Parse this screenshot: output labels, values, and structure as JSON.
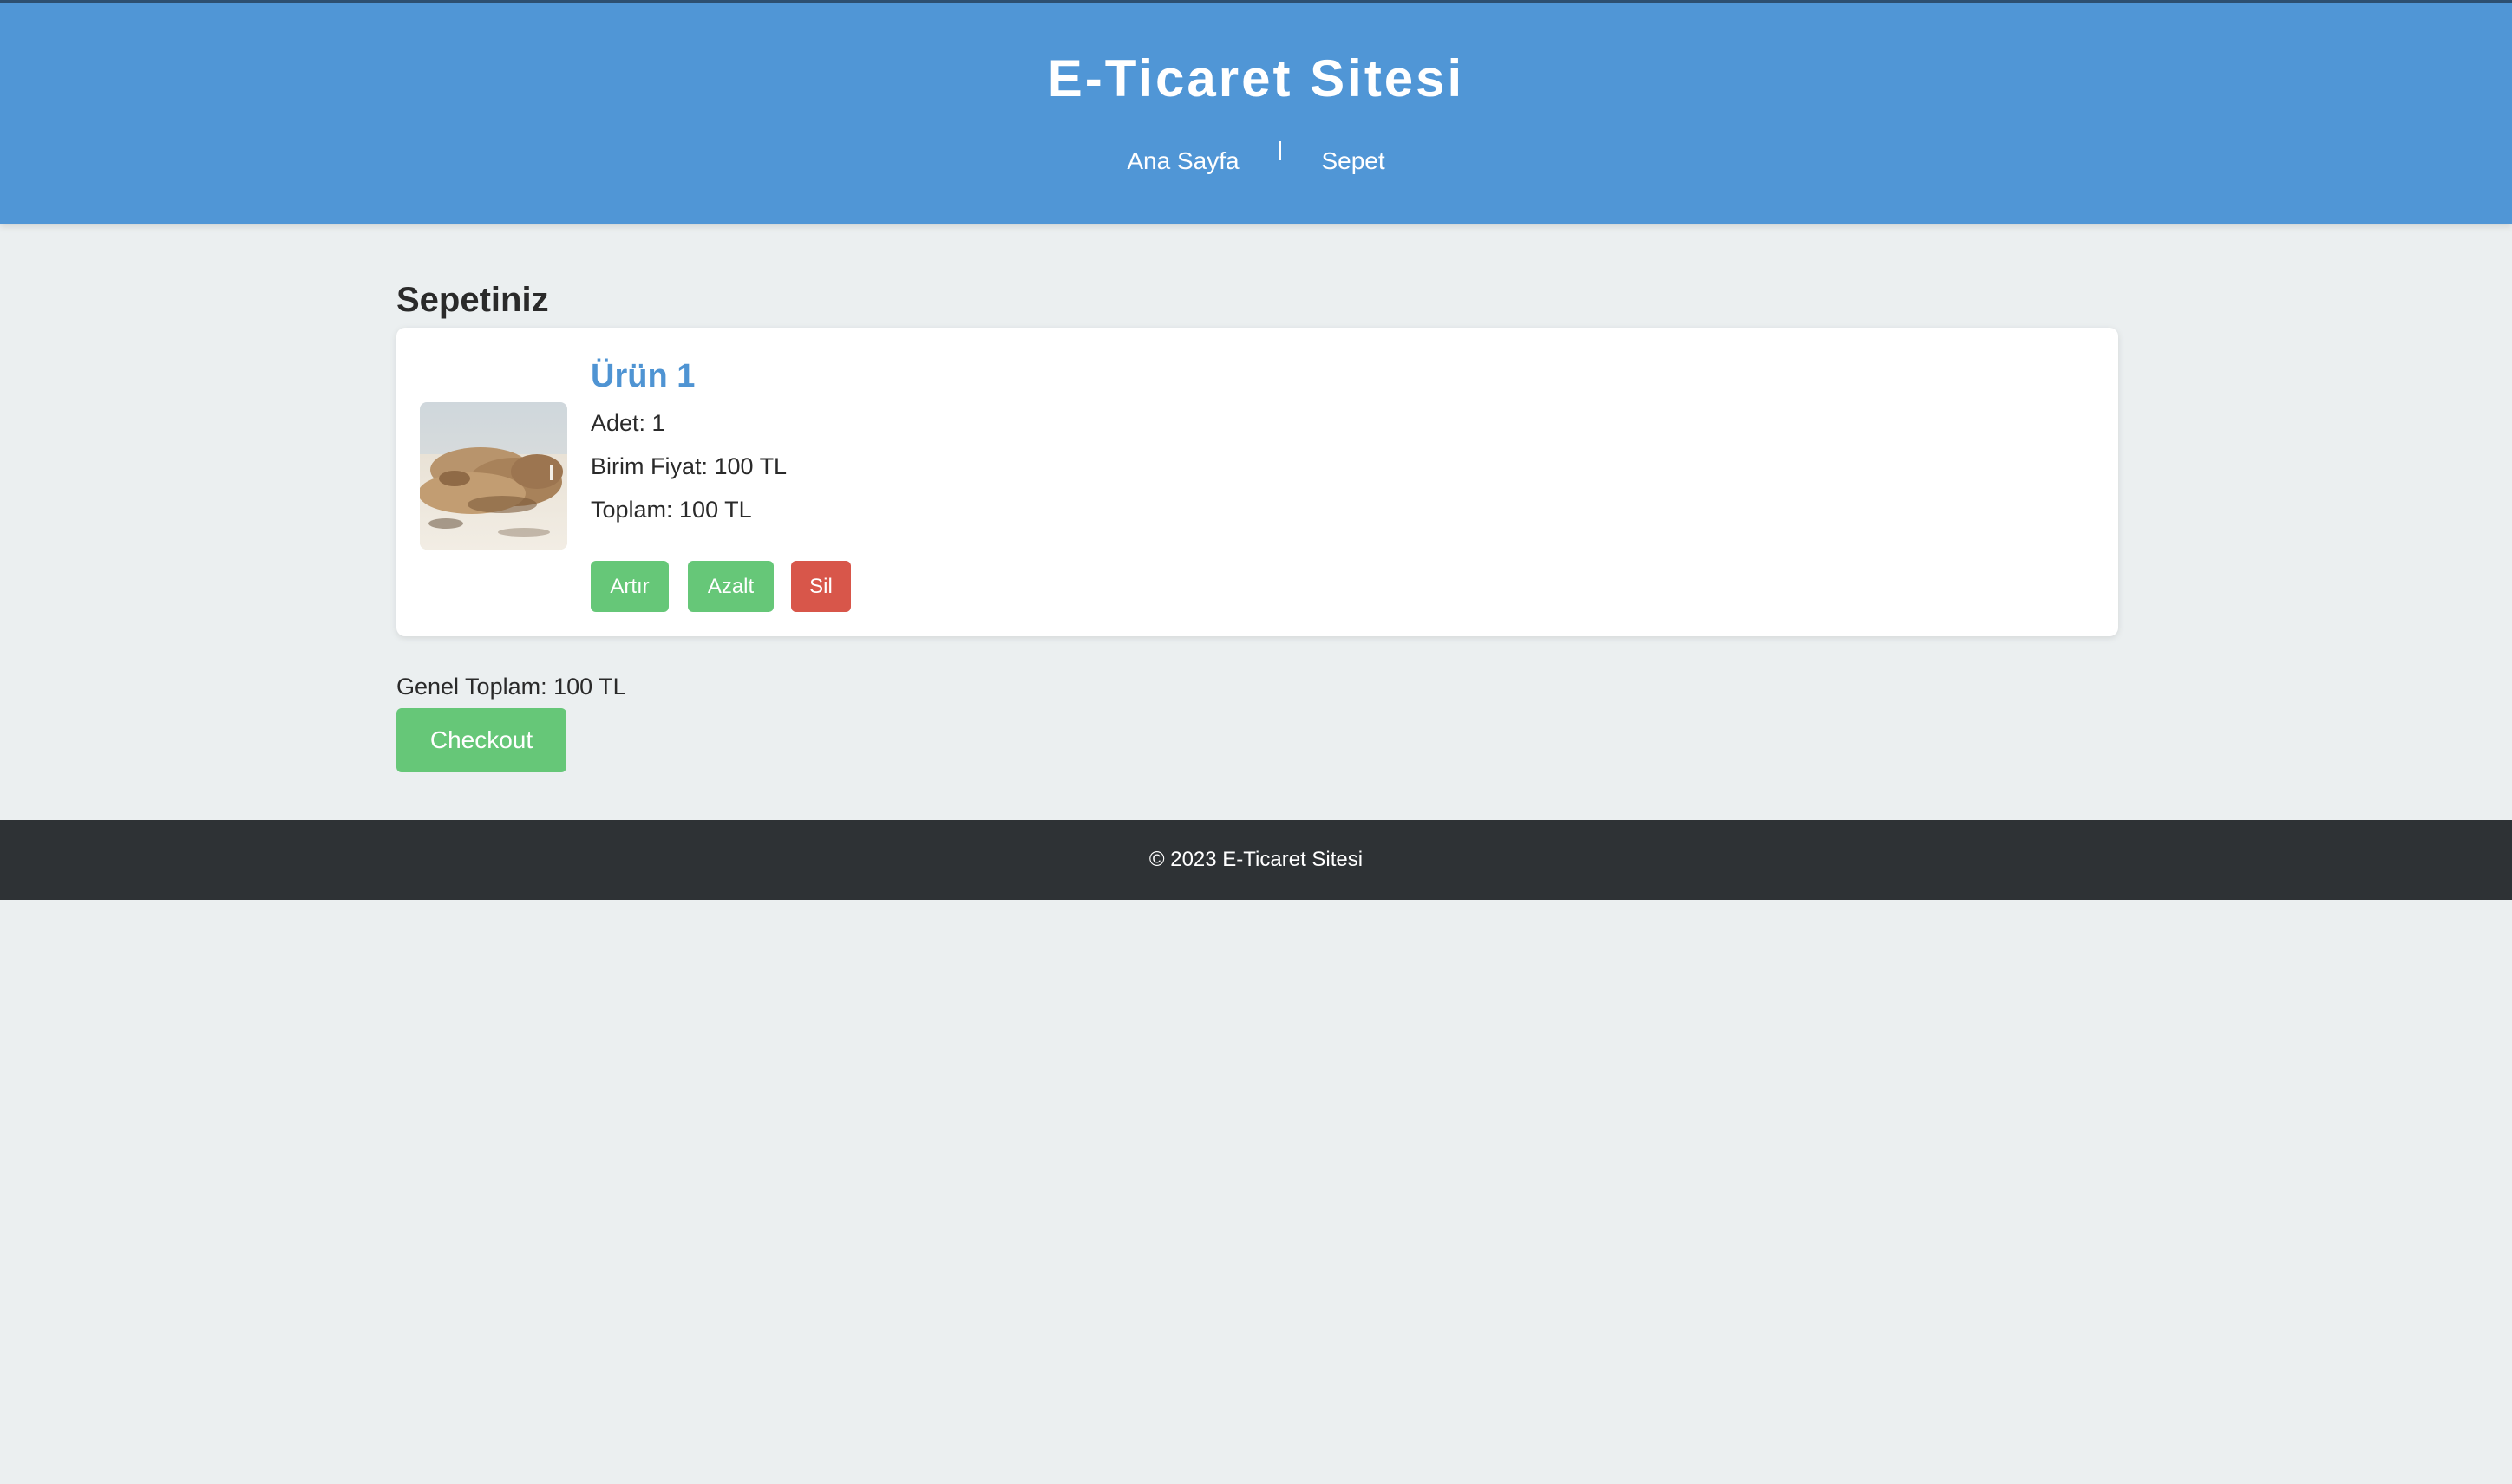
{
  "header": {
    "title": "E-Ticaret Sitesi",
    "nav": {
      "home": "Ana Sayfa",
      "cart": "Sepet"
    }
  },
  "cart": {
    "heading": "Sepetiniz",
    "items": [
      {
        "name": "Ürün 1",
        "quantity_text": "Adet: 1",
        "unit_price_text": "Birim Fiyat: 100 TL",
        "total_text": "Toplam: 100 TL",
        "buttons": {
          "increase": "Artır",
          "decrease": "Azalt",
          "remove": "Sil"
        }
      }
    ],
    "grand_total_text": "Genel Toplam: 100 TL",
    "checkout_label": "Checkout"
  },
  "footer": {
    "text": "© 2023 E-Ticaret Sitesi"
  },
  "colors": {
    "header_bg": "#5096d6",
    "page_bg": "#ebeff0",
    "accent_blue": "#4f94d3",
    "green_button": "#66c778",
    "red_button": "#d8564a",
    "footer_bg": "#2e3235"
  }
}
